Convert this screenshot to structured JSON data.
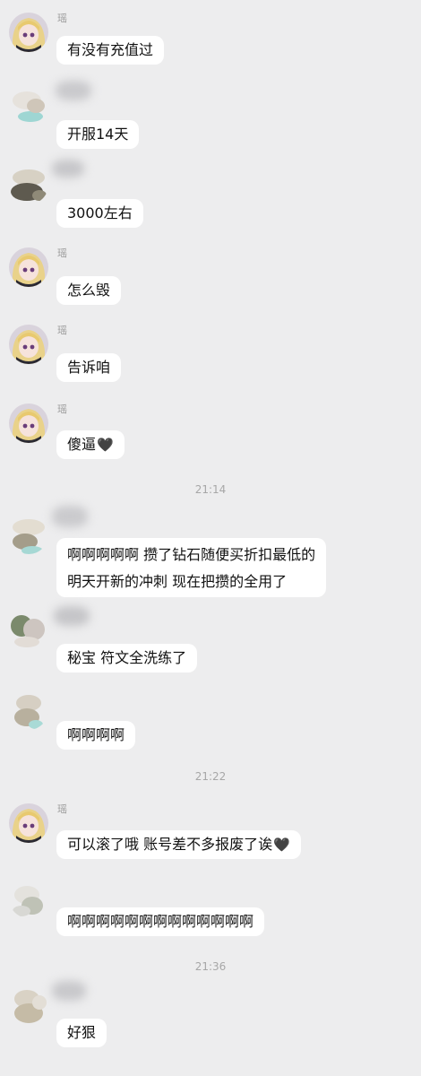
{
  "chat": {
    "messages": [
      {
        "sender": "瑶",
        "avatar": "anime-girl-avatar",
        "text": "有没有充值过"
      },
      {
        "sender": "",
        "avatar": "blurred-avatar",
        "text": "开服14天"
      },
      {
        "sender": "",
        "avatar": "blurred-avatar",
        "text": "3000左右"
      },
      {
        "sender": "瑶",
        "avatar": "anime-girl-avatar",
        "text": "怎么毁"
      },
      {
        "sender": "瑶",
        "avatar": "anime-girl-avatar",
        "text": "告诉咱"
      },
      {
        "sender": "瑶",
        "avatar": "anime-girl-avatar",
        "text": "傻逼",
        "icon": "black-heart-icon"
      },
      {
        "time": "21:14"
      },
      {
        "sender": "",
        "avatar": "blurred-avatar",
        "lines": [
          "啊啊啊啊啊 攒了钻石随便买折扣最低的",
          "明天开新的冲刺 现在把攒的全用了"
        ]
      },
      {
        "sender": "",
        "avatar": "blurred-avatar",
        "text": "秘宝 符文全洗练了"
      },
      {
        "sender": "",
        "avatar": "blurred-avatar",
        "text": "啊啊啊啊"
      },
      {
        "time": "21:22"
      },
      {
        "sender": "瑶",
        "avatar": "anime-girl-avatar",
        "text": "可以滚了哦 账号差不多报废了诶",
        "icon": "black-heart-icon"
      },
      {
        "sender": "",
        "avatar": "blurred-avatar",
        "text": "啊啊啊啊啊啊啊啊啊啊啊啊啊"
      },
      {
        "time": "21:36"
      },
      {
        "sender": "",
        "avatar": "blurred-avatar",
        "text": "好狠"
      }
    ],
    "heart_glyph": "🖤",
    "colors": {
      "background": "#ededee",
      "bubble": "#ffffff",
      "timestamp": "#a7a7a7"
    }
  }
}
